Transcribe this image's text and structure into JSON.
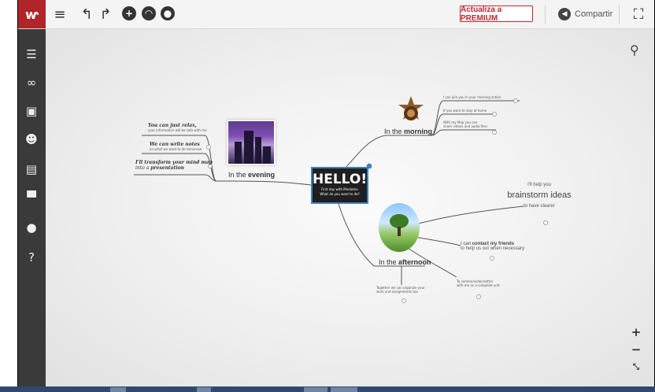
{
  "toolbar": {
    "logo": "mindomo-logo",
    "premium_label": "Actualiza a PREMIUM",
    "share_label": "Compartir"
  },
  "sidebar": {
    "items": [
      "outline-icon",
      "link-icon",
      "image-icon",
      "smiley-icon",
      "notes-icon",
      "comment-icon",
      "idea-icon",
      "help-icon"
    ]
  },
  "map": {
    "center": {
      "title": "HELLO!",
      "line1": "First day with Mindomo",
      "line2": "What do you want to do?"
    },
    "evening": {
      "prefix": "In the ",
      "bold": "evening",
      "subs": [
        {
          "title": "You can just relax,",
          "detail": "your information will be safe with me"
        },
        {
          "title": "We can write notes",
          "detail": "on what we want to do tomorrow"
        },
        {
          "title": "I'll transform your mind map",
          "detail_prefix": "into a ",
          "detail_bold": "presentation"
        }
      ]
    },
    "morning": {
      "prefix": "In the ",
      "bold": "morning",
      "subs": [
        "I can join you in your morning action",
        "If you want to stay at home",
        "With my Map you can",
        "share videos and audio files"
      ]
    },
    "afternoon": {
      "prefix": "In the ",
      "bold": "afternoon",
      "brainstorm": {
        "line1": "I'll help you",
        "line2": "brainstorm ideas",
        "line3": "to have clearer"
      },
      "contact": {
        "prefix": "I can ",
        "bold": "contact my friends",
        "line2": "to help us out when necessary"
      },
      "communicate": {
        "line1": "To communicate better",
        "line2": "with me as a complete unit"
      },
      "together": {
        "line1": "Together we can organize your",
        "line2": "work and assignments too"
      }
    }
  },
  "colors": {
    "brand": "#b0252a",
    "sidebar": "#3a3a3a",
    "accent": "#3b82c4"
  }
}
